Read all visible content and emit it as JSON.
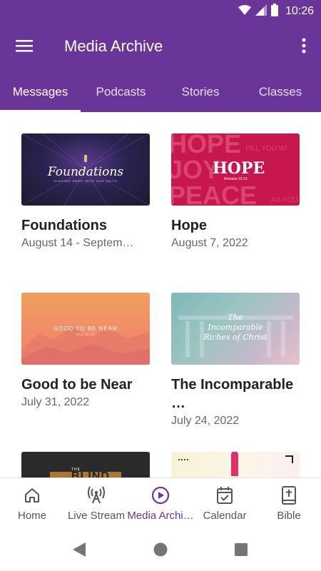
{
  "status": {
    "time": "10:26"
  },
  "app_bar": {
    "title": "Media Archive"
  },
  "tabs": [
    {
      "label": "Messages",
      "active": true
    },
    {
      "label": "Podcasts",
      "active": false
    },
    {
      "label": "Stories",
      "active": false
    },
    {
      "label": "Classes",
      "active": false
    }
  ],
  "cards": [
    {
      "title": "Foundations",
      "date": "August 14 - Septem…",
      "thumb_title": "Foundations",
      "thumb_sub": "DIGGING DEEP INTO OUR FAITH"
    },
    {
      "title": "Hope",
      "date": "August 7, 2022",
      "thumb_title": "HOPE",
      "thumb_sub": "Romans 15:13",
      "thumb_bg_words": [
        "HOPE",
        "JOY",
        "PEACE"
      ],
      "thumb_side_words": [
        "FILL YOU WI",
        "AS YOU"
      ]
    },
    {
      "title": "Good to be Near",
      "date": "July 31, 2022",
      "thumb_title": "GOOD TO BE NEAR",
      "thumb_sub": "PSALM 73"
    },
    {
      "title": "The Incomparable …",
      "date": "July 24, 2022",
      "thumb_title": "The Incomparable Riches of Christ"
    },
    {
      "title": "",
      "date": "",
      "thumb_title": "BLIND",
      "thumb_sub": "THE"
    },
    {
      "title": "",
      "date": ""
    }
  ],
  "bottom_nav": [
    {
      "label": "Home",
      "icon": "home-icon",
      "active": false
    },
    {
      "label": "Live Stream",
      "icon": "antenna-icon",
      "active": false
    },
    {
      "label": "Media Archi…",
      "icon": "play-circle-icon",
      "active": true
    },
    {
      "label": "Calendar",
      "icon": "calendar-check-icon",
      "active": false
    },
    {
      "label": "Bible",
      "icon": "bible-icon",
      "active": false
    }
  ],
  "colors": {
    "primary": "#6a3598",
    "on_primary": "#ffffff",
    "active_nav": "#6a3598"
  }
}
